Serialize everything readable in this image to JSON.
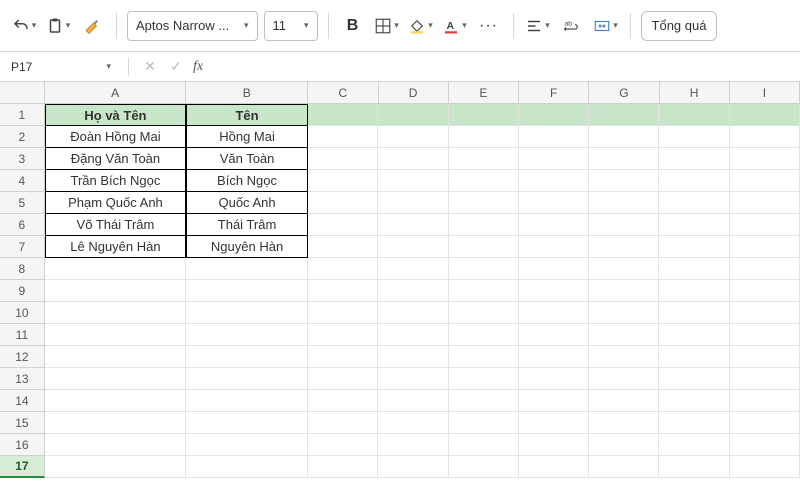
{
  "toolbar": {
    "font_name": "Aptos Narrow ...",
    "font_size": "11",
    "overview_label": "Tổng quá"
  },
  "formula_bar": {
    "name_box": "P17",
    "fx_label": "fx",
    "value": ""
  },
  "grid": {
    "columns": [
      "A",
      "B",
      "C",
      "D",
      "E",
      "F",
      "G",
      "H",
      "I"
    ],
    "row_count": 17,
    "selected_row": 17,
    "headers": {
      "A": "Họ và Tên",
      "B": "Tên"
    },
    "data": [
      {
        "A": "Đoàn Hồng Mai",
        "B": "Hồng Mai"
      },
      {
        "A": "Đặng Văn Toàn",
        "B": "Văn Toàn"
      },
      {
        "A": "Trần Bích Ngọc",
        "B": "Bích Ngọc"
      },
      {
        "A": "Phạm Quốc Anh",
        "B": "Quốc Anh"
      },
      {
        "A": "Võ Thái Trâm",
        "B": "Thái Trâm"
      },
      {
        "A": "Lê Nguyên Hàn",
        "B": "Nguyên Hàn"
      }
    ]
  }
}
